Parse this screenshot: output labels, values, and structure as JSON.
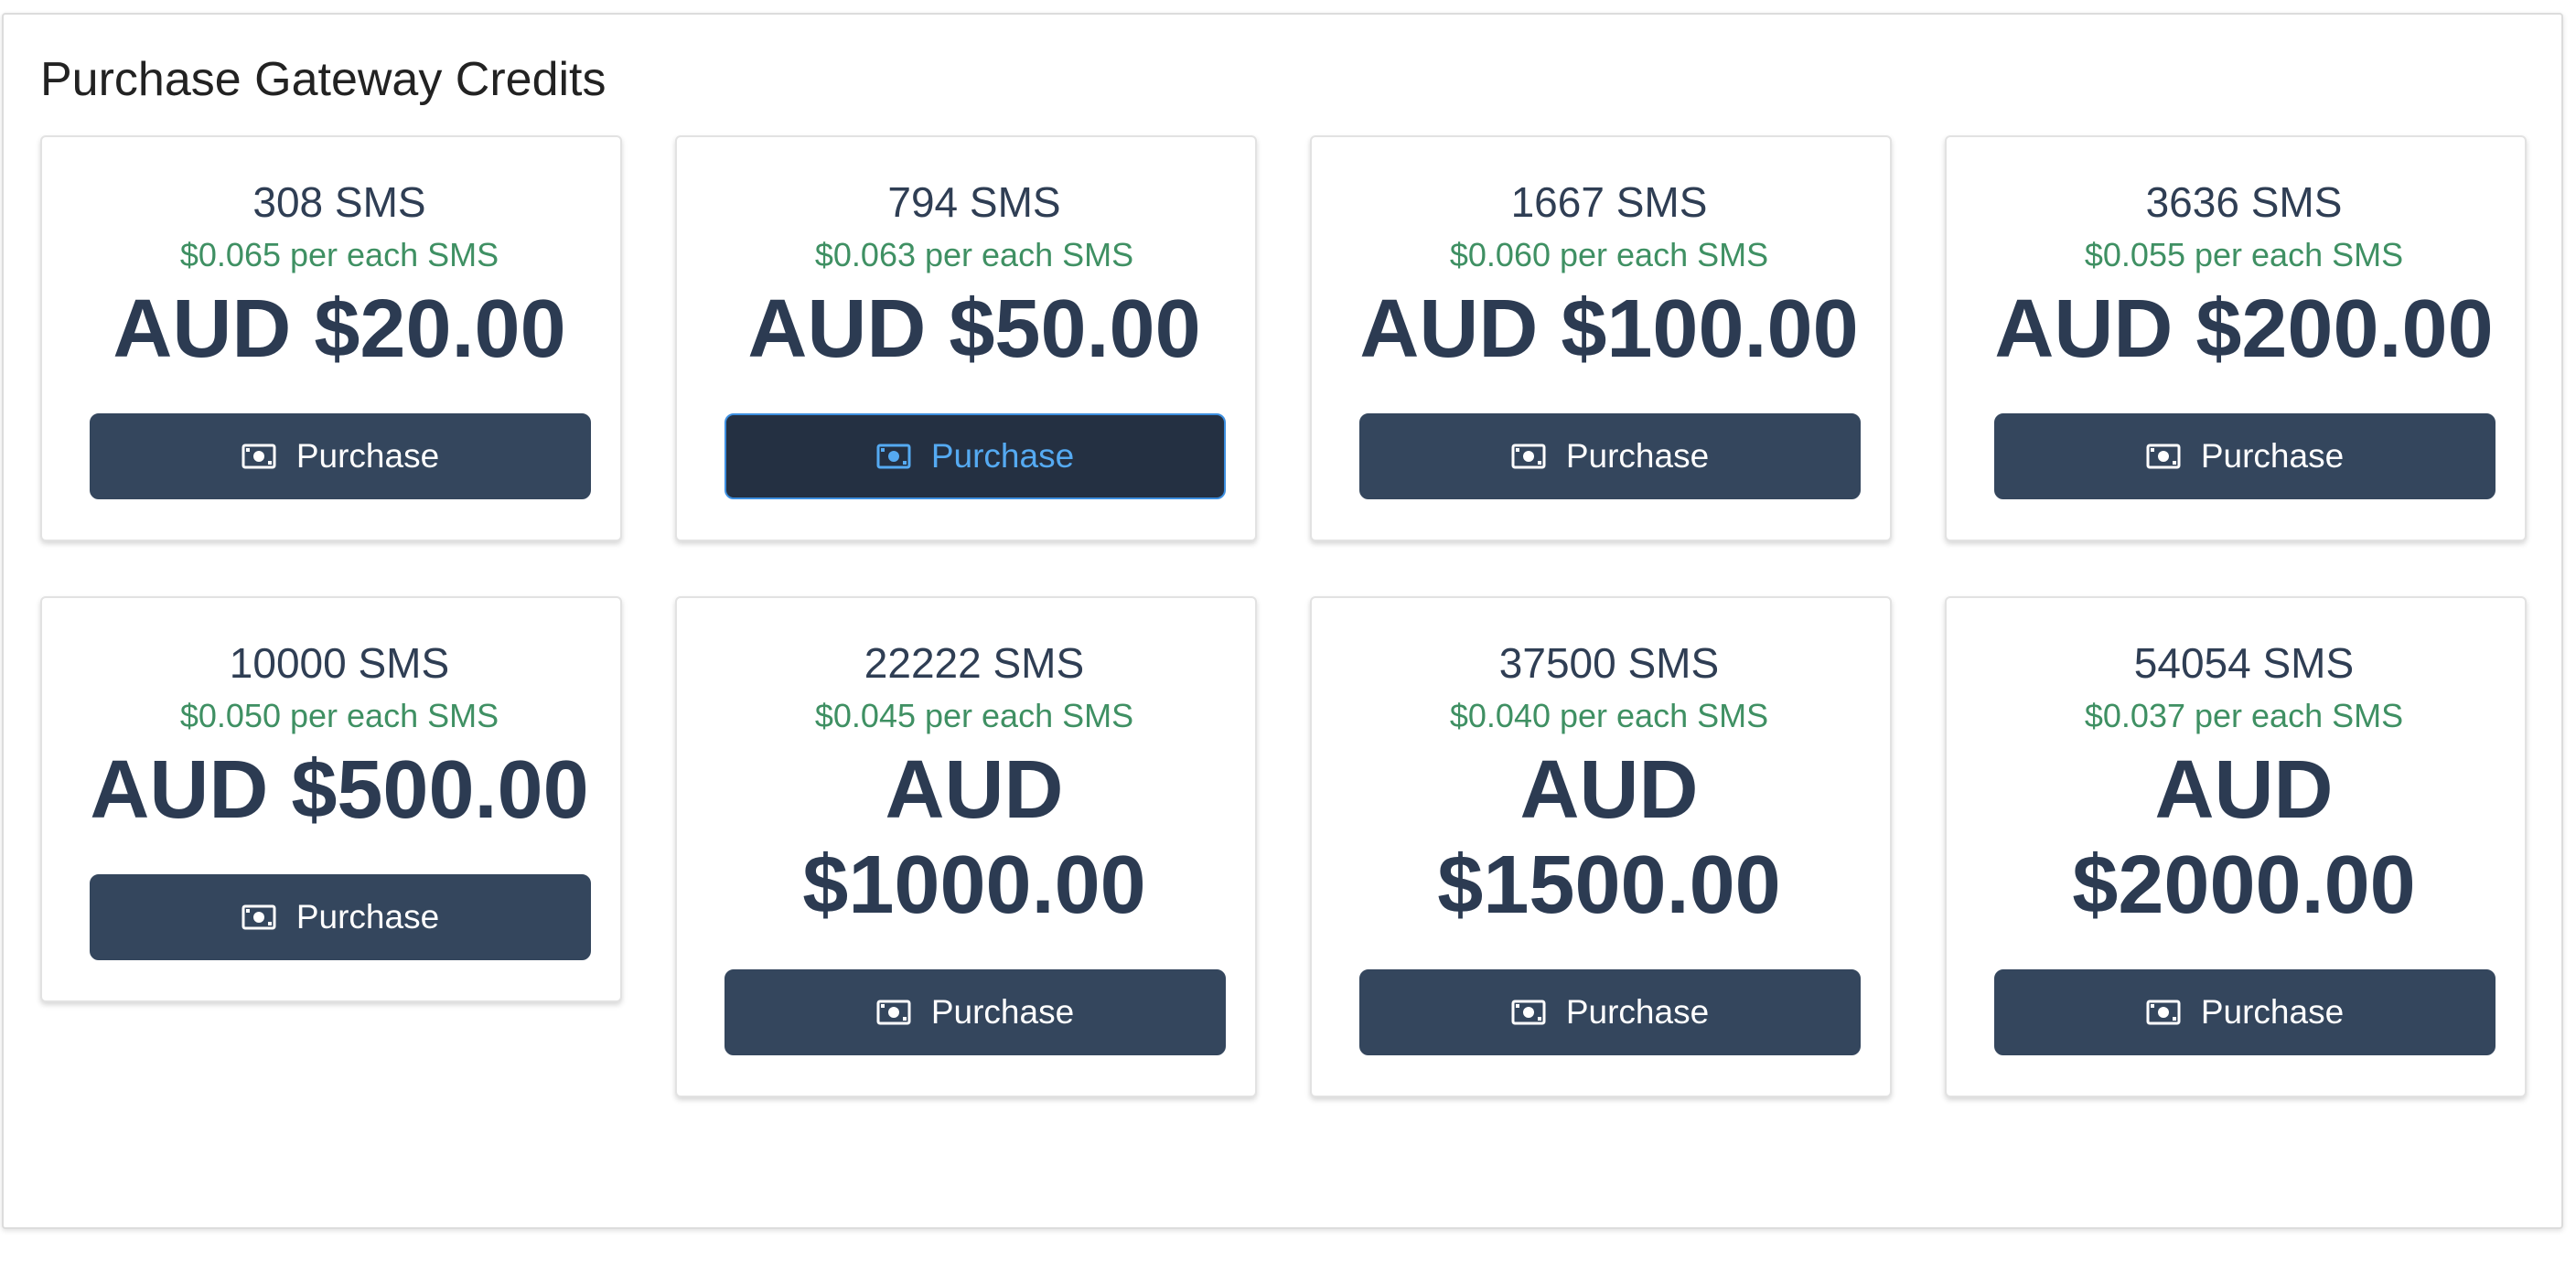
{
  "panel": {
    "title": "Purchase Gateway Credits"
  },
  "colors": {
    "button_bg": "#34465d",
    "button_focused_bg": "#243042",
    "button_focused_text": "#55aaf2",
    "rate_text": "#3f9063",
    "price_text": "#2c3b52"
  },
  "packages": [
    {
      "sms": "308 SMS",
      "rate": "$0.065 per each SMS",
      "price_line1": "AUD $20.00",
      "price_line2": "",
      "button_label": "Purchase",
      "button_icon": "money-bill-icon"
    },
    {
      "sms": "794 SMS",
      "rate": "$0.063 per each SMS",
      "price_line1": "AUD $50.00",
      "price_line2": "",
      "button_label": "Purchase",
      "button_icon": "money-bill-icon",
      "focused": true
    },
    {
      "sms": "1667 SMS",
      "rate": "$0.060 per each SMS",
      "price_line1": "AUD $100.00",
      "price_line2": "",
      "button_label": "Purchase",
      "button_icon": "money-bill-icon"
    },
    {
      "sms": "3636 SMS",
      "rate": "$0.055 per each SMS",
      "price_line1": "AUD $200.00",
      "price_line2": "",
      "button_label": "Purchase",
      "button_icon": "money-bill-icon"
    },
    {
      "sms": "10000 SMS",
      "rate": "$0.050 per each SMS",
      "price_line1": "AUD $500.00",
      "price_line2": "",
      "button_label": "Purchase",
      "button_icon": "money-bill-icon"
    },
    {
      "sms": "22222 SMS",
      "rate": "$0.045 per each SMS",
      "price_line1": "AUD",
      "price_line2": "$1000.00",
      "button_label": "Purchase",
      "button_icon": "money-bill-icon"
    },
    {
      "sms": "37500 SMS",
      "rate": "$0.040 per each SMS",
      "price_line1": "AUD",
      "price_line2": "$1500.00",
      "button_label": "Purchase",
      "button_icon": "money-bill-icon"
    },
    {
      "sms": "54054 SMS",
      "rate": "$0.037 per each SMS",
      "price_line1": "AUD",
      "price_line2": "$2000.00",
      "button_label": "Purchase",
      "button_icon": "money-bill-icon"
    }
  ]
}
